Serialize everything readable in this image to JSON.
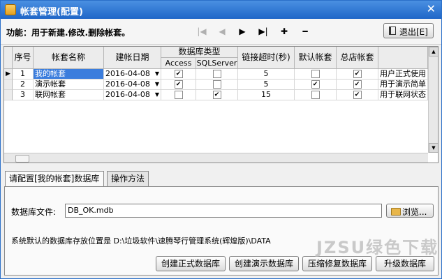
{
  "window": {
    "title": "帐套管理(配置)",
    "close": "✕"
  },
  "toolbar": {
    "func_label": "功能：用于新建.修改.删除帐套。",
    "nav_first": "|◀",
    "nav_prev": "◀",
    "nav_next": "▶",
    "nav_last": "▶|",
    "add": "✚",
    "remove": "━",
    "exit_label": "退出[E]"
  },
  "grid": {
    "headers": {
      "seq": "序号",
      "name": "帐套名称",
      "date": "建帐日期",
      "dbtype": "数据库类型",
      "access": "Access",
      "sqlserver": "SQLServer",
      "timeout": "链接超时(秒)",
      "default": "默认帐套",
      "hq": "总店帐套"
    },
    "rows": [
      {
        "seq": "1",
        "name": "我的帐套",
        "date": "2016-04-08",
        "access": true,
        "sqlserver": false,
        "timeout": "5",
        "default": false,
        "hq": true,
        "note": "用户正式使用"
      },
      {
        "seq": "2",
        "name": "演示帐套",
        "date": "2016-04-08",
        "access": true,
        "sqlserver": false,
        "timeout": "5",
        "default": true,
        "hq": true,
        "note": "用于演示简单"
      },
      {
        "seq": "3",
        "name": "联网帐套",
        "date": "2016-04-08",
        "access": false,
        "sqlserver": true,
        "timeout": "15",
        "default": false,
        "hq": true,
        "note": "用于联网状态"
      }
    ]
  },
  "tabs": [
    "请配置[我的帐套]数据库",
    "操作方法"
  ],
  "panel": {
    "file_label": "数据库文件:",
    "file_value": "DB_OK.mdb",
    "browse_label": "浏览...",
    "default_path_text": "系统默认的数据库存放位置是 D:\\垃圾软件\\速腾琴行管理系统(辉煌版)\\DATA",
    "buttons": [
      "创建正式数据库",
      "创建演示数据库",
      "压缩修复数据库",
      "升级数据库"
    ]
  },
  "watermark": "JZSU绿色下载"
}
